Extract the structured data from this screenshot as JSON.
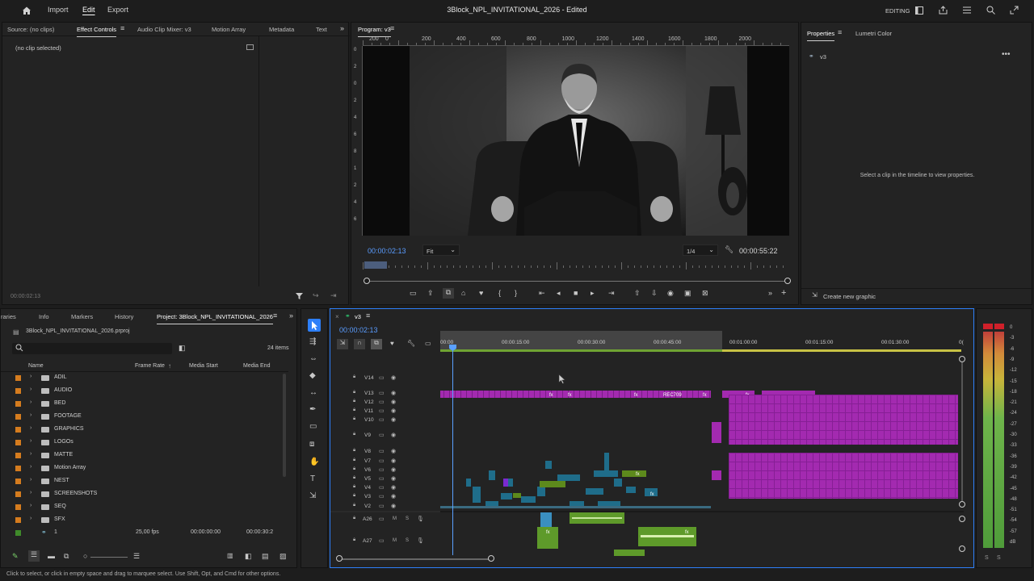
{
  "app": {
    "nav": {
      "home_icon": "home-icon",
      "import": "Import",
      "edit": "Edit",
      "export": "Export"
    },
    "title": "3Block_NPL_INVITATIONAL_2026 - Edited",
    "workspace": "EDITING",
    "right_icons": [
      "workspace-icon",
      "share-icon",
      "menu-icon",
      "search-icon",
      "bell-icon",
      "fullscreen-icon"
    ]
  },
  "source_panel": {
    "tabs": [
      "Source: (no clips)",
      "Effect Controls",
      "Audio Clip Mixer: v3",
      "Motion Array",
      "Metadata",
      "Text"
    ],
    "active_tab": "Effect Controls",
    "no_clip": "(no clip selected)",
    "timecode": "00:00:02:13"
  },
  "program_monitor": {
    "tab": "Program: v3",
    "ruler_labels": [
      "200",
      "0",
      "200",
      "400",
      "600",
      "800",
      "1000",
      "1200",
      "1400",
      "1600",
      "1800",
      "2000"
    ],
    "left_ruler_labels": [
      "0",
      "2",
      "0",
      "2",
      "4",
      "6",
      "8",
      "1",
      "2",
      "4",
      "6"
    ],
    "timecode": "00:00:02:13",
    "fit": "Fit",
    "quality": "1/4",
    "duration": "00:00:55:22"
  },
  "properties_panel": {
    "tabs": [
      "Properties",
      "Lumetri Color"
    ],
    "active_tab": "Properties",
    "sequence": "v3",
    "hint": "Select a clip in the timeline to view properties.",
    "create_graphic": "Create new graphic"
  },
  "project_panel": {
    "tabs": [
      "raries",
      "Info",
      "Markers",
      "History",
      "Project: 3Block_NPL_INVITATIONAL_2026"
    ],
    "active_tab": "Project: 3Block_NPL_INVITATIONAL_2026",
    "file": "3Block_NPL_INVITATIONAL_2026.prproj",
    "item_count": "24 items",
    "columns": [
      "Name",
      "Frame Rate",
      "Media Start",
      "Media End"
    ],
    "folders": [
      "ADIL",
      "AUDIO",
      "BED",
      "FOOTAGE",
      "GRAPHICS",
      "LOGOs",
      "MATTE",
      "Motion Array",
      "NEST",
      "SCREENSHOTS",
      "SEQ",
      "SFX"
    ],
    "sequence_row": {
      "name": "1",
      "frame_rate": "25,00 fps",
      "media_start": "00:00:00:00",
      "media_end": "00:00:30:2"
    }
  },
  "timeline": {
    "tab": "v3",
    "timecode": "00:00:02:13",
    "ruler_labels": [
      "00:00",
      "00:00:15:00",
      "00:00:30:00",
      "00:00:45:00",
      "00:01:00:00",
      "00:01:15:00",
      "00:01:30:00",
      "0("
    ],
    "video_tracks": [
      "V14",
      "V13",
      "V12",
      "V11",
      "V10",
      "V9",
      "V8",
      "V7",
      "V6",
      "V5",
      "V4",
      "V3",
      "V2"
    ],
    "audio_tracks": [
      "A26",
      "A27"
    ],
    "clip_label": "REC709",
    "fx": "fx"
  },
  "audio_meter": {
    "scale": [
      "0",
      "-6",
      "-12",
      "-18",
      "-24",
      "-30",
      "-36",
      "-42",
      "-48",
      "-54"
    ],
    "scale_labels": [
      "0",
      "-3",
      "-6",
      "-9",
      "-12",
      "-15",
      "-18",
      "-21",
      "-24",
      "-27",
      "-30",
      "-33",
      "-36",
      "-39",
      "-42",
      "-45",
      "-48",
      "-51",
      "-54",
      "-57",
      "dB"
    ],
    "solo": [
      "S",
      "S"
    ]
  },
  "status": "Click to select, or click in empty space and drag to marquee select. Use Shift, Opt, and Cmd for other options.",
  "colors": {
    "accent_blue": "#2d7ff9",
    "magenta_clip": "#a32ab0",
    "green_audio": "#5e9a2a",
    "teal_clip": "#1f6d8a",
    "folder_orange": "#d57c1e"
  }
}
